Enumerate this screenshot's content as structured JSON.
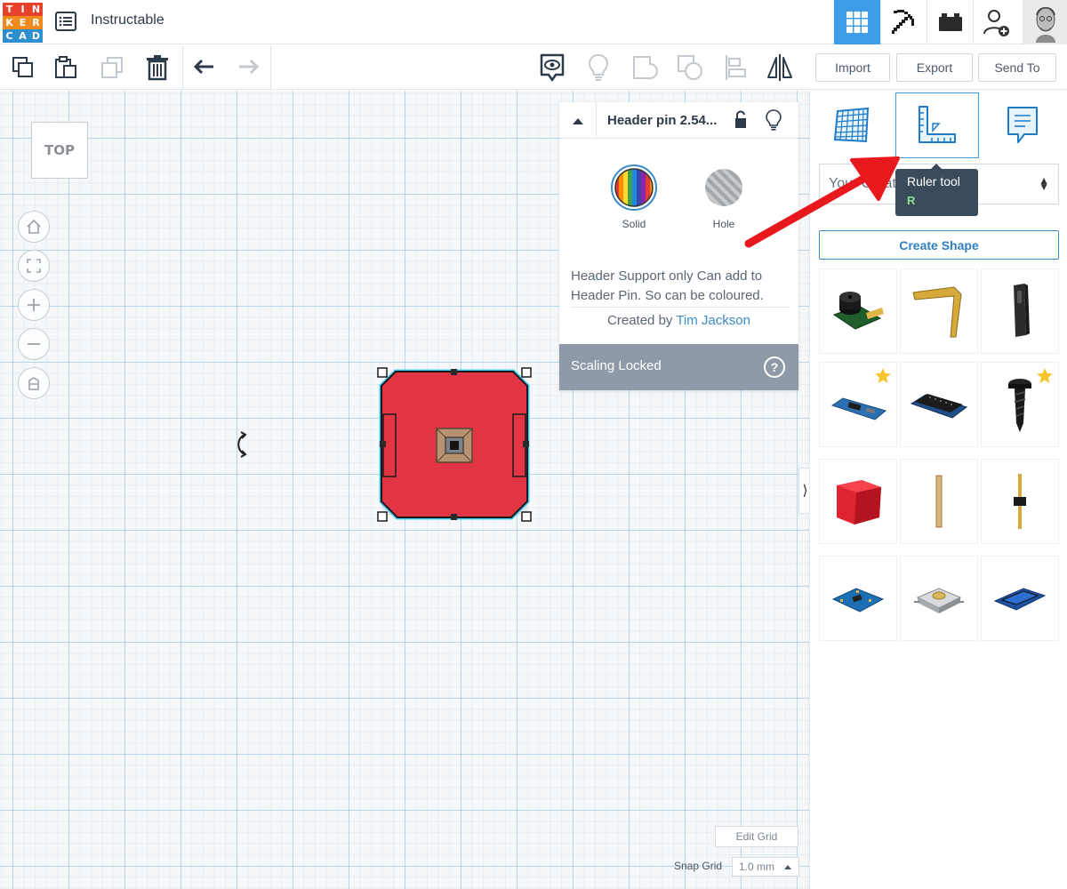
{
  "app": {
    "logo_letters": [
      "T",
      "I",
      "N",
      "K",
      "E",
      "R",
      "C",
      "A",
      "D"
    ],
    "logo_colors": [
      "#e8412c",
      "#e8412c",
      "#e8412c",
      "#f08a1d",
      "#f08a1d",
      "#f08a1d",
      "#2d8fcf",
      "#2d8fcf",
      "#2d8fcf"
    ],
    "doc_title": "Instructable"
  },
  "topnav": {
    "items": [
      {
        "icon": "3d-grid-icon",
        "active": true
      },
      {
        "icon": "pickaxe-icon",
        "active": false
      },
      {
        "icon": "bricks-icon",
        "active": false
      },
      {
        "icon": "add-user-icon",
        "active": false
      },
      {
        "icon": "avatar",
        "active": false
      }
    ],
    "active_color": "#3d9de8"
  },
  "toolbar": {
    "tools": [
      "copy-icon",
      "paste-icon",
      "duplicate-icon",
      "delete-icon",
      "undo-icon",
      "redo-icon"
    ],
    "view_tools": [
      "show-hide-icon",
      "lightbulb-icon",
      "group-icon",
      "ungroup-icon",
      "align-icon",
      "mirror-icon"
    ]
  },
  "actions": {
    "import_label": "Import",
    "export_label": "Export",
    "send_to_label": "Send To"
  },
  "workplane": {
    "viewcube_label": "TOP",
    "nav_buttons": [
      "home-icon",
      "fit-view-icon",
      "zoom-in-icon",
      "zoom-out-icon",
      "ortho-icon"
    ],
    "edit_grid_label": "Edit Grid",
    "snap_grid_label": "Snap Grid",
    "snap_grid_value": "1.0 mm"
  },
  "inspector": {
    "title": "Header pin 2.54...",
    "solid_label": "Solid",
    "hole_label": "Hole",
    "description": "Header Support only Can add to Header Pin. So can be coloured.",
    "created_by_label": "Created by",
    "author": "Tim Jackson",
    "footer_label": "Scaling Locked",
    "help_glyph": "?"
  },
  "right_panel": {
    "tabs": [
      {
        "icon": "workplane-grid-icon",
        "active": false
      },
      {
        "icon": "ruler-icon",
        "active": true
      },
      {
        "icon": "notes-icon",
        "active": false
      }
    ],
    "library_select_value": "Your Creations",
    "create_shape_label": "Create Shape",
    "parts": [
      {
        "name": "buzzer-module",
        "starred": false
      },
      {
        "name": "bent-header-pin",
        "starred": false
      },
      {
        "name": "header-socket",
        "starred": false
      },
      {
        "name": "blue-pcb-board",
        "starred": true
      },
      {
        "name": "arduino-nano",
        "starred": false
      },
      {
        "name": "screw",
        "starred": true
      },
      {
        "name": "red-header-support",
        "starred": false
      },
      {
        "name": "straight-pin",
        "starred": false
      },
      {
        "name": "header-pin",
        "starred": false
      },
      {
        "name": "sensor-board",
        "starred": false
      },
      {
        "name": "tactile-switch",
        "starred": false
      },
      {
        "name": "lcd-module",
        "starred": false
      }
    ]
  },
  "tooltip": {
    "title": "Ruler tool",
    "shortcut": "R"
  },
  "colors": {
    "shape_red": "#e23544",
    "selection_cyan": "#47c8f0",
    "accent_blue": "#3d9de8",
    "annotation_arrow": "#e8191c"
  }
}
